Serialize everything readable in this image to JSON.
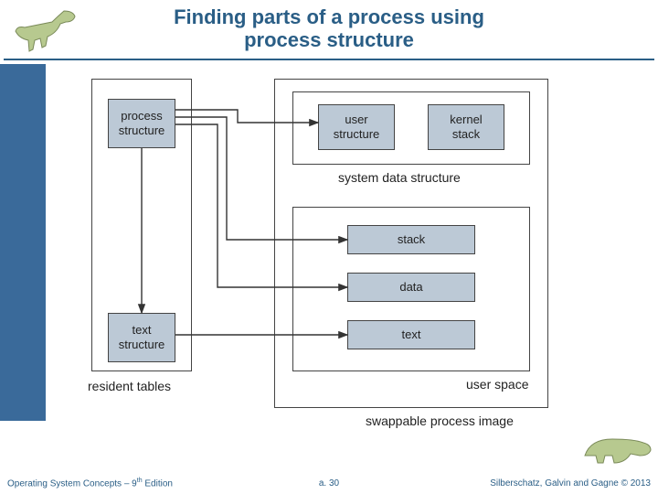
{
  "title_line1": "Finding parts of a process using",
  "title_line2": "process structure",
  "footer": {
    "left_prefix": "Operating System Concepts – 9",
    "left_suffix": " Edition",
    "left_sup": "th",
    "center": "a. 30",
    "right": "Silberschatz, Galvin and Gagne © 2013"
  },
  "diagram": {
    "resident_tables": {
      "process_structure": "process\nstructure",
      "text_structure": "text\nstructure",
      "label": "resident tables"
    },
    "swappable": {
      "system_data": {
        "user_structure": "user\nstructure",
        "kernel_stack": "kernel\nstack",
        "label": "system data structure"
      },
      "user_space": {
        "stack": "stack",
        "data": "data",
        "text": "text",
        "label": "user space"
      },
      "label": "swappable process image"
    }
  },
  "icons": {
    "top_left": "dinosaur-theropod-icon",
    "bottom_right": "dinosaur-hadrosaur-icon"
  }
}
